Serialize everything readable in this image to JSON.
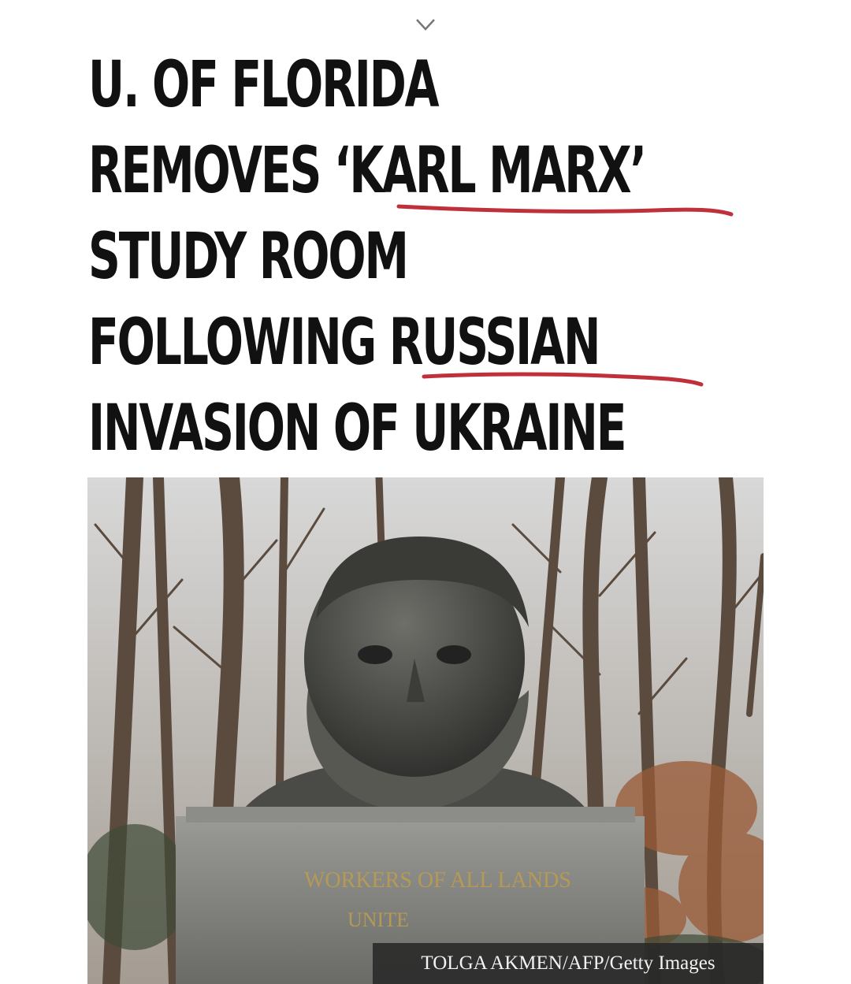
{
  "headline": {
    "lines": [
      "U. OF FLORIDA",
      "REMOVES ‘KARL MARX’",
      "STUDY ROOM",
      "FOLLOWING RUSSIAN",
      "INVASION OF UKRAINE"
    ]
  },
  "photo": {
    "plinth_inscription_line1": "WORKERS OF ALL LANDS",
    "plinth_inscription_line2": "UNITE",
    "credit": "TOLGA AKMEN/AFP/Getty Images"
  },
  "colors": {
    "text": "#111111",
    "underline": "#c0303a",
    "credit_bg": "#282828"
  },
  "icons": [
    "chevron-down-icon"
  ]
}
